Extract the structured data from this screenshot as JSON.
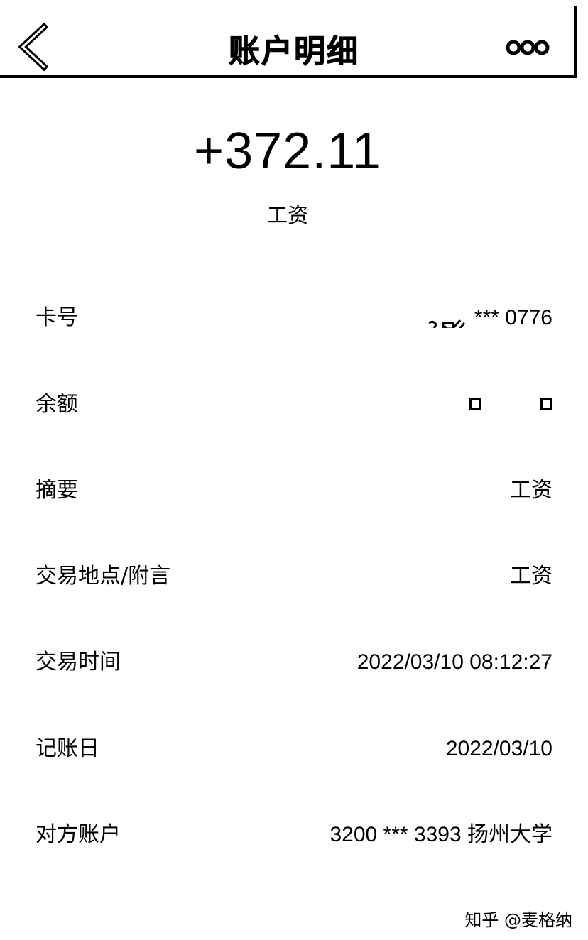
{
  "nav": {
    "title": "账户明细",
    "back_icon": "chevron-left-icon",
    "more_icon": "more-dots-icon"
  },
  "transaction": {
    "amount": "+372.11",
    "description": "工资"
  },
  "details": {
    "card_number": {
      "label": "卡号",
      "value": "*** 0776"
    },
    "balance": {
      "label": "余额",
      "value_hidden": true
    },
    "summary": {
      "label": "摘要",
      "value": "工资"
    },
    "location_note": {
      "label": "交易地点/附言",
      "value": "工资"
    },
    "time": {
      "label": "交易时间",
      "value": "2022/03/10 08:12:27"
    },
    "posting_date": {
      "label": "记账日",
      "value": "2022/03/10"
    },
    "counterparty": {
      "label": "对方账户",
      "value": "3200 *** 3393 扬州大学"
    }
  },
  "watermark": {
    "text": "知乎 @麦格纳"
  }
}
